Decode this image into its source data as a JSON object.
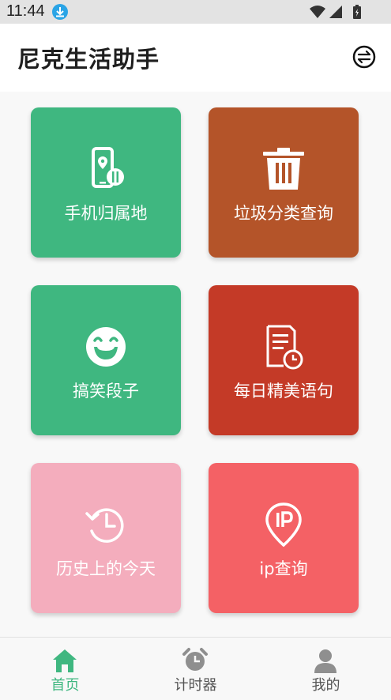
{
  "status_bar": {
    "time": "11:44"
  },
  "header": {
    "title": "尼克生活助手",
    "switch_icon": "swap-icon"
  },
  "cards": [
    {
      "label": "手机归属地",
      "color": "#3fb780",
      "icon": "phone-location-icon"
    },
    {
      "label": "垃圾分类查询",
      "color": "#b45429",
      "icon": "trash-can-icon"
    },
    {
      "label": "搞笑段子",
      "color": "#3fb780",
      "icon": "laughing-face-icon"
    },
    {
      "label": "每日精美语句",
      "color": "#c43a27",
      "icon": "document-clock-icon"
    },
    {
      "label": "历史上的今天",
      "color": "#f4adbd",
      "icon": "history-icon"
    },
    {
      "label": "ip查询",
      "color": "#f46165",
      "icon": "ip-pin-icon"
    }
  ],
  "bottom_nav": {
    "active_color": "#3fb780",
    "inactive_color": "#555555",
    "items": [
      {
        "label": "首页",
        "icon": "home-icon",
        "active": true
      },
      {
        "label": "计时器",
        "icon": "alarm-clock-icon",
        "active": false
      },
      {
        "label": "我的",
        "icon": "user-icon",
        "active": false
      }
    ]
  }
}
